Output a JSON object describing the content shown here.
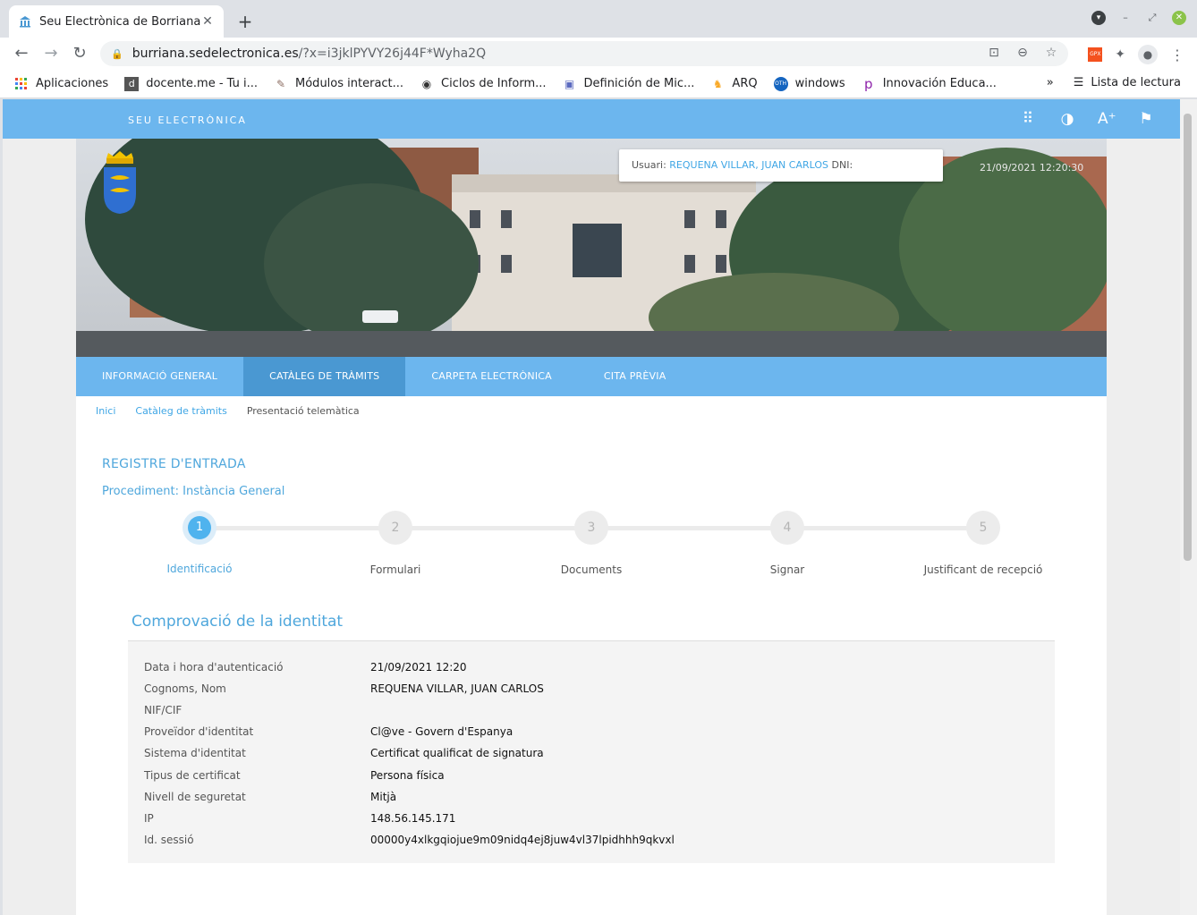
{
  "browser": {
    "tab_title": "Seu Electrònica de Borriana",
    "url_host": "burriana.sedelectronica.es",
    "url_path": "/?x=i3jklPYVY26j44F*Wyha2Q",
    "bookmarks": [
      {
        "label": "Aplicaciones",
        "icon": "apps-grid-icon"
      },
      {
        "label": "docente.me - Tu i...",
        "icon": "docente-icon"
      },
      {
        "label": "Módulos interact...",
        "icon": "modulos-icon"
      },
      {
        "label": "Ciclos de Inform...",
        "icon": "globe-icon"
      },
      {
        "label": "Definición de Mic...",
        "icon": "lock-site-icon"
      },
      {
        "label": "ARQ",
        "icon": "arq-icon"
      },
      {
        "label": "windows",
        "icon": "windows-icon"
      },
      {
        "label": "Innovación Educa...",
        "icon": "innovacion-icon"
      }
    ],
    "more_bookmarks": "»",
    "reading_list": "Lista de lectura"
  },
  "site": {
    "brand": "SEU ELECTRÒNICA",
    "user_label": "Usuari:",
    "user_name": "REQUENA VILLAR, JUAN CARLOS",
    "dni_label": "DNI:",
    "datestamp": "21/09/2021 12:20:30",
    "nav": [
      "INFORMACIÓ GENERAL",
      "CATÀLEG DE TRÀMITS",
      "CARPETA ELECTRÒNICA",
      "CITA PRÈVIA"
    ],
    "nav_active": 1,
    "breadcrumb": [
      "Inici",
      "Catàleg de tràmits",
      "Presentació telemàtica"
    ]
  },
  "form": {
    "section_title": "REGISTRE D'ENTRADA",
    "procedure": "Procediment: Instància General",
    "steps": [
      {
        "num": "1",
        "label": "Identificació"
      },
      {
        "num": "2",
        "label": "Formulari"
      },
      {
        "num": "3",
        "label": "Documents"
      },
      {
        "num": "4",
        "label": "Signar"
      },
      {
        "num": "5",
        "label": "Justificant de recepció"
      }
    ],
    "current_step": 1,
    "subtitle": "Comprovació de la identitat",
    "rows": [
      {
        "key": "Data i hora d'autenticació",
        "value": "21/09/2021 12:20"
      },
      {
        "key": "Cognoms, Nom",
        "value": "REQUENA VILLAR, JUAN CARLOS"
      },
      {
        "key": "NIF/CIF",
        "value": ""
      },
      {
        "key": "Proveïdor d'identitat",
        "value": "Cl@ve - Govern d'Espanya"
      },
      {
        "key": "Sistema d'identitat",
        "value": "Certificat qualificat de signatura"
      },
      {
        "key": "Tipus de certificat",
        "value": "Persona física"
      },
      {
        "key": "Nivell de seguretat",
        "value": "Mitjà"
      },
      {
        "key": "IP",
        "value": "148.56.145.171"
      },
      {
        "key": "Id. sessió",
        "value": "00000y4xlkgqiojue9m09nidq4ej8juw4vl37lpidhhh9qkvxl"
      }
    ]
  },
  "colors": {
    "accent": "#6cb6ee",
    "nav_active": "#4a98d2",
    "link": "#4fa7dc"
  }
}
